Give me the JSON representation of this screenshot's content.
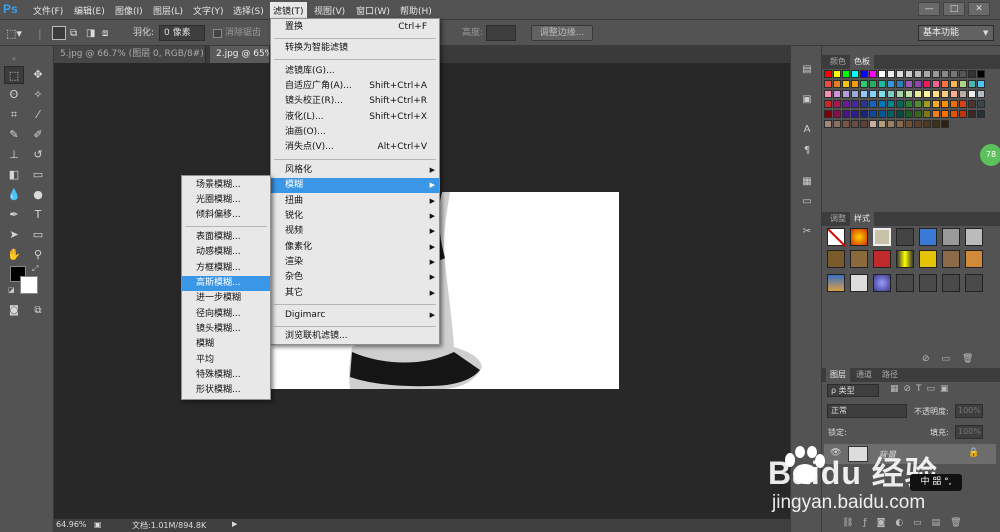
{
  "app": {
    "logo": "Ps"
  },
  "menubar": {
    "items": [
      "文件(F)",
      "编辑(E)",
      "图像(I)",
      "图层(L)",
      "文字(Y)",
      "选择(S)",
      "滤镜(T)",
      "视图(V)",
      "窗口(W)",
      "帮助(H)"
    ],
    "window_buttons": [
      "—",
      "□",
      "✕"
    ]
  },
  "options": {
    "feather_label": "羽化:",
    "feather_value": "0 像素",
    "antialias_label": "消除锯齿",
    "height_label": "高度:",
    "refine_edge": "调整边缘...",
    "workspace": "基本功能"
  },
  "tabs": [
    "5.jpg @ 66.7% (图层 0, RGB/8#) *",
    "2.jpg @ 65%(",
    ""
  ],
  "status": {
    "zoom": "64.96%",
    "doc": "文档:1.01M/894.8K"
  },
  "filter_menu": {
    "items": [
      {
        "label": "置换",
        "shortcut": "Ctrl+F"
      },
      {
        "label": "转换为智能滤镜",
        "shortcut": ""
      },
      {
        "label": "滤镜库(G)...",
        "shortcut": ""
      },
      {
        "label": "自适应广角(A)...",
        "shortcut": "Shift+Ctrl+A"
      },
      {
        "label": "镜头校正(R)...",
        "shortcut": "Shift+Ctrl+R"
      },
      {
        "label": "液化(L)...",
        "shortcut": "Shift+Ctrl+X"
      },
      {
        "label": "油画(O)...",
        "shortcut": ""
      },
      {
        "label": "消失点(V)...",
        "shortcut": "Alt+Ctrl+V"
      },
      {
        "label": "风格化",
        "shortcut": ""
      },
      {
        "label": "模糊",
        "shortcut": ""
      },
      {
        "label": "扭曲",
        "shortcut": ""
      },
      {
        "label": "锐化",
        "shortcut": ""
      },
      {
        "label": "视频",
        "shortcut": ""
      },
      {
        "label": "像素化",
        "shortcut": ""
      },
      {
        "label": "渲染",
        "shortcut": ""
      },
      {
        "label": "杂色",
        "shortcut": ""
      },
      {
        "label": "其它",
        "shortcut": ""
      },
      {
        "label": "Digimarc",
        "shortcut": ""
      },
      {
        "label": "浏览联机滤镜...",
        "shortcut": ""
      }
    ]
  },
  "blur_submenu": {
    "items": [
      "场景模糊...",
      "光圈模糊...",
      "倾斜偏移...",
      "表面模糊...",
      "动感模糊...",
      "方框模糊...",
      "高斯模糊...",
      "进一步模糊",
      "径向模糊...",
      "镜头模糊...",
      "模糊",
      "平均",
      "特殊模糊...",
      "形状模糊..."
    ]
  },
  "panels": {
    "color_tabs": [
      "颜色",
      "色板"
    ],
    "style_tabs": [
      "调整",
      "样式"
    ],
    "layer_tabs": [
      "图层",
      "通道",
      "路径"
    ],
    "layer_filter": "类型",
    "blend_mode": "正常",
    "opacity_label": "不透明度:",
    "opacity_value": "100%",
    "lock_label": "锁定:",
    "fill_label": "填充:",
    "fill_value": "100%",
    "layer_name": "背景",
    "badge": "78"
  },
  "watermark": {
    "brand": "Baidu 经验",
    "url": "jingyan.baidu.com",
    "ime": "中 㗊 °,"
  },
  "colors": {
    "highlight": "#3a96e6",
    "menubar": "#535353",
    "canvas": "#282828"
  }
}
